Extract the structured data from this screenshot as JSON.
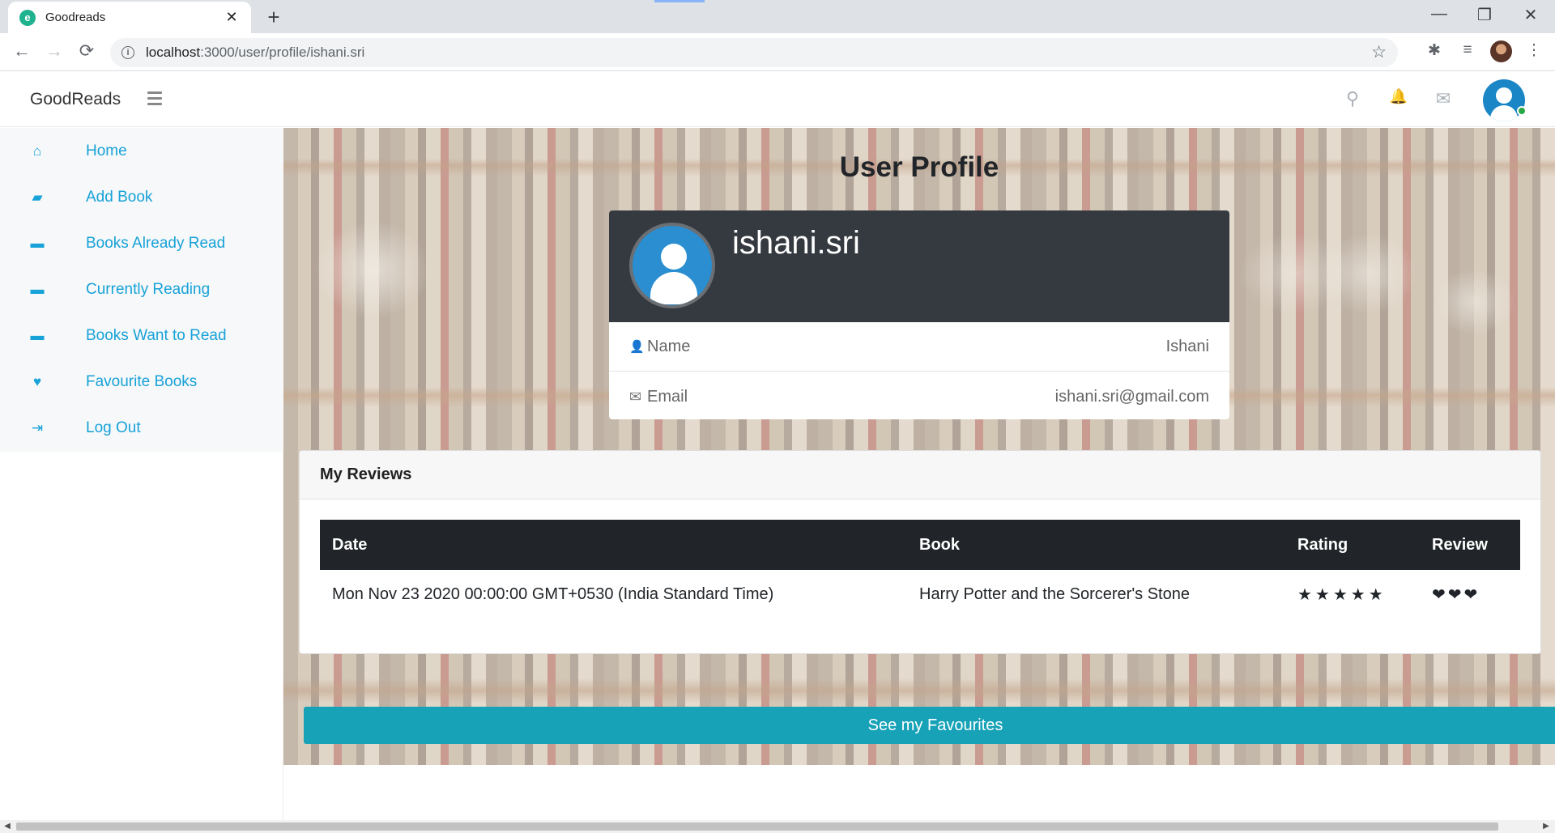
{
  "browser": {
    "tab_title": "Goodreads",
    "tab_favicon": "e",
    "close_glyph": "✕",
    "new_tab_glyph": "+",
    "url_host": "localhost",
    "url_path": ":3000/user/profile/ishani.sri",
    "back_glyph": "←",
    "forward_glyph": "→",
    "reload_glyph": "⟳",
    "star_glyph": "☆",
    "minimize_glyph": "—",
    "restore_glyph": "❐",
    "window_close_glyph": "✕",
    "extensions_glyph": "✱",
    "media_glyph": "≡",
    "menu_glyph": "⋮"
  },
  "navbar": {
    "brand": "GoodReads",
    "icons": [
      "search-icon",
      "bell-icon",
      "envelope-icon",
      "user-avatar"
    ],
    "search_glyph": "⚲",
    "bell_glyph": "🔔",
    "envelope_glyph": "✉"
  },
  "sidebar": {
    "items": [
      {
        "label": "Home",
        "icon": "home-icon",
        "glyph": "⌂"
      },
      {
        "label": "Add Book",
        "icon": "book-icon",
        "glyph": "▰"
      },
      {
        "label": "Books Already Read",
        "icon": "briefcase-icon",
        "glyph": "▬"
      },
      {
        "label": "Currently Reading",
        "icon": "briefcase-icon",
        "glyph": "▬"
      },
      {
        "label": "Books Want to Read",
        "icon": "briefcase-icon",
        "glyph": "▬"
      },
      {
        "label": "Favourite Books",
        "icon": "heart-icon",
        "glyph": "♥"
      },
      {
        "label": "Log Out",
        "icon": "sign-out-icon",
        "glyph": "⇥"
      }
    ],
    "accent_color": "#17a2d8"
  },
  "main": {
    "page_title": "User Profile",
    "profile": {
      "username": "ishani.sri",
      "name_label": "Name",
      "name_value": "Ishani",
      "email_label": "Email",
      "email_value": "ishani.sri@gmail.com",
      "user_glyph": "👤",
      "mail_glyph": "✉"
    },
    "reviews": {
      "title": "My Reviews",
      "columns": [
        "Date",
        "Book",
        "Rating",
        "Review"
      ],
      "rows": [
        {
          "date": "Mon Nov 23 2020 00:00:00 GMT+0530 (India Standard Time)",
          "book": "Harry Potter and the Sorcerer's Stone",
          "rating": "★★★★★",
          "rating_value": 5,
          "review": "❤❤❤"
        }
      ]
    },
    "favourites_button": "See my Favourites",
    "button_color": "#17a2b8"
  },
  "scrollbar": {
    "left_arrow": "◀",
    "right_arrow": "▶"
  }
}
